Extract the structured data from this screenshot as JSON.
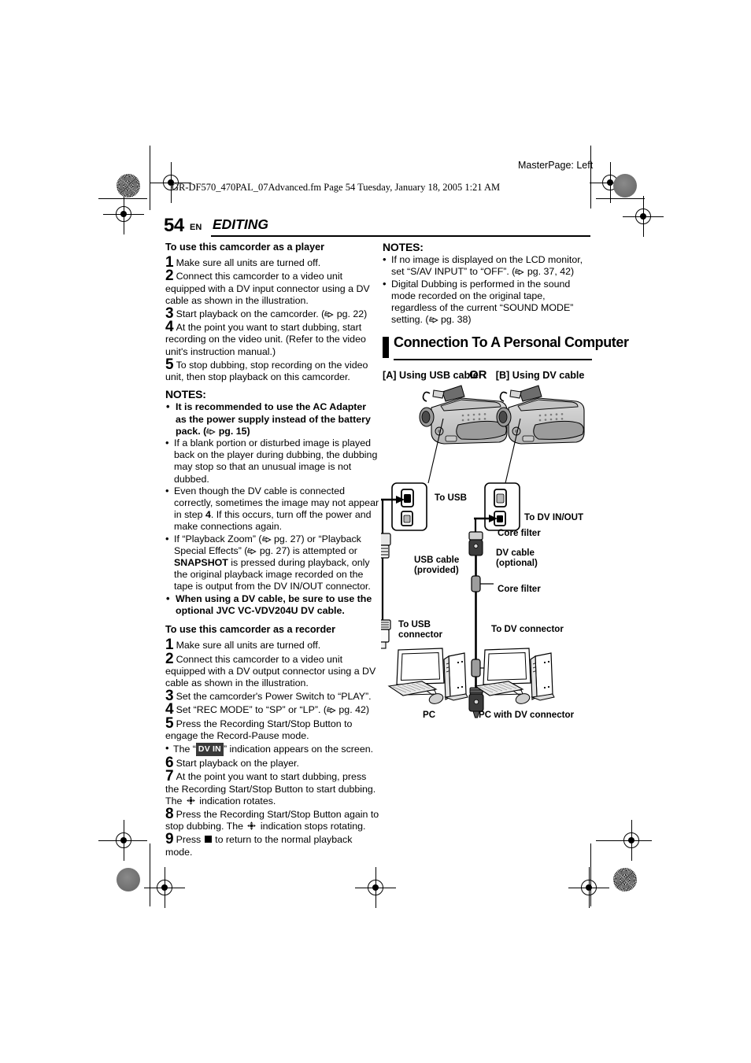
{
  "print_header": {
    "masterpage": "MasterPage: Left",
    "filename_line": "GR-DF570_470PAL_07Advanced.fm  Page 54  Tuesday, January 18, 2005  1:21 AM"
  },
  "page_head": {
    "page_number": "54",
    "language_code": "EN",
    "section": "EDITING"
  },
  "left_column": {
    "player_heading": "To use this camcorder as a player",
    "player_steps": [
      {
        "n": "1",
        "text": "Make sure all units are turned off."
      },
      {
        "n": "2",
        "text": "Connect this camcorder to a video unit equipped with a DV input connector using a DV cable as shown in the illustration."
      },
      {
        "n": "3",
        "text": "Start playback on the camcorder. (☞ pg. 22)"
      },
      {
        "n": "4",
        "text": "At the point you want to start dubbing, start recording on the video unit. (Refer to the video unit's instruction manual.)"
      },
      {
        "n": "5",
        "text": "To stop dubbing, stop recording on the video unit, then stop playback on this camcorder."
      }
    ],
    "notes_heading": "NOTES:",
    "notes": [
      {
        "bold": true,
        "text": "It is recommended to use the AC Adapter as the power supply instead of the battery pack. (☞ pg. 15)"
      },
      {
        "bold": false,
        "text": "If a blank portion or disturbed image is played back on the player during dubbing, the dubbing may stop so that an unusual image is not dubbed."
      },
      {
        "bold": false,
        "text": "Even though the DV cable is connected correctly, sometimes the image may not appear in step 4. If this occurs, turn off the power and make connections again."
      },
      {
        "bold": false,
        "text": "If “Playback Zoom” (☞ pg. 27) or “Playback Special Effects” (☞ pg. 27) is attempted or SNAPSHOT is pressed during playback, only the original playback image recorded on the tape is output from the DV IN/OUT connector."
      },
      {
        "bold": true,
        "text": "When using a DV cable, be sure to use the optional JVC VC-VDV204U DV cable."
      }
    ],
    "recorder_heading": "To use this camcorder as a recorder",
    "recorder_steps": [
      {
        "n": "1",
        "text": "Make sure all units are turned off."
      },
      {
        "n": "2",
        "text": "Connect this camcorder to a video unit equipped with a DV output connector using a DV cable as shown in the illustration."
      },
      {
        "n": "3",
        "text": "Set the camcorder's Power Switch to “PLAY”."
      },
      {
        "n": "4",
        "text": "Set “REC MODE” to “SP” or “LP”. (☞ pg. 42)"
      },
      {
        "n": "5",
        "text": "Press the Recording Start/Stop Button to engage the Record-Pause mode."
      },
      {
        "n": "6",
        "text": "Start playback on the player."
      },
      {
        "n": "7",
        "text": "At the point you want to start dubbing, press the Recording Start/Stop Button to start dubbing. The  indication rotates."
      },
      {
        "n": "8",
        "text": "Press the Recording Start/Stop Button again to stop dubbing. The  indication stops rotating."
      },
      {
        "n": "9",
        "text": "Press  to return to the normal playback mode."
      }
    ],
    "dvin_bullet_prefix": "The “",
    "dvin_badge": "DV IN",
    "dvin_bullet_suffix": "” indication appears on the screen."
  },
  "right_column": {
    "notes_heading": "NOTES:",
    "notes": [
      "If no image is displayed on the LCD monitor, set “S/AV INPUT” to “OFF”. (☞ pg. 37, 42)",
      "Digital Dubbing is performed in the sound mode recorded on the original tape, regardless of the current “SOUND MODE” setting. (☞ pg. 38)"
    ],
    "section_title": "Connection To A Personal Computer",
    "option_a": "[A]  Using USB cable",
    "option_b": "[B]  Using DV cable"
  },
  "diagram": {
    "or_label": "OR",
    "labels": {
      "to_usb": "To USB",
      "to_dv_in_out": "To DV IN/OUT",
      "core_filter_top": "Core filter",
      "core_filter_bottom": "Core filter",
      "usb_cable": "USB cable\n(provided)",
      "usb_cable_line1": "USB cable",
      "usb_cable_line2": "(provided)",
      "dv_cable_line1": "DV cable",
      "dv_cable_line2": "(optional)",
      "to_usb_connector_line1": "To USB",
      "to_usb_connector_line2": "connector",
      "to_dv_connector": "To DV connector",
      "pc": "PC",
      "pc_with_dv": "PC with DV connector"
    }
  },
  "colors": {
    "ink": "#000000",
    "body_light": "#d2d2d2",
    "body_mid": "#b0b0b0",
    "body_dark": "#8d8d8d",
    "badge_bg": "#3a3a3a"
  }
}
